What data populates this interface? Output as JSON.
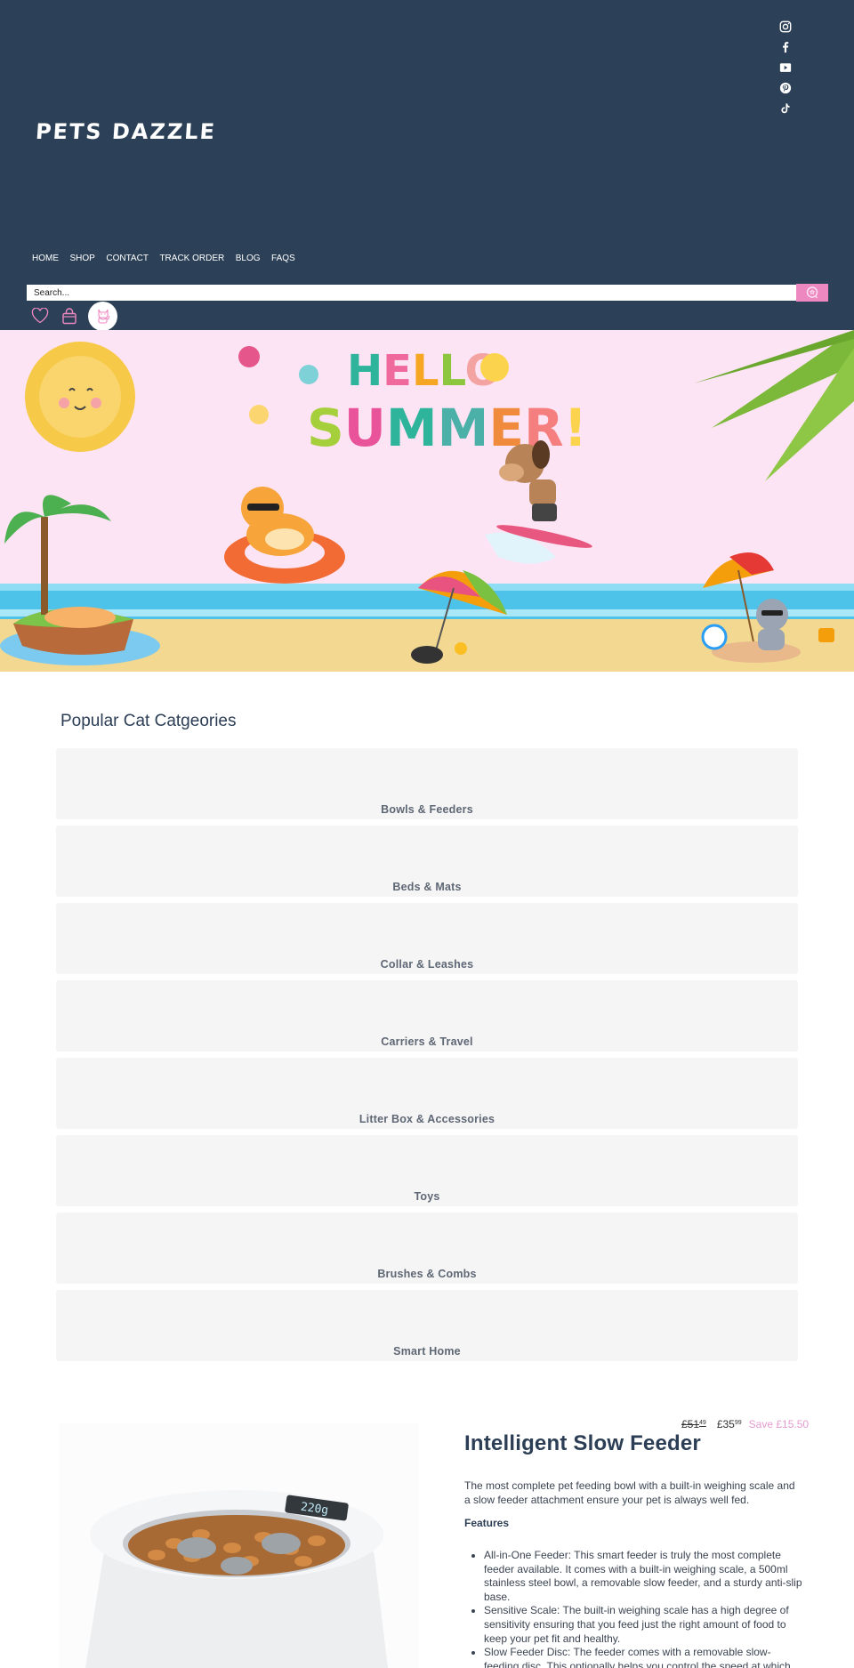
{
  "brand": {
    "name": "PETS DAZZLE"
  },
  "social": [
    {
      "icon": "instagram-icon",
      "label": "Instagram"
    },
    {
      "icon": "facebook-icon",
      "label": "Facebook"
    },
    {
      "icon": "youtube-icon",
      "label": "YouTube"
    },
    {
      "icon": "pinterest-icon",
      "label": "Pinterest"
    },
    {
      "icon": "tiktok-icon",
      "label": "TikTok"
    }
  ],
  "nav": [
    "HOME",
    "SHOP",
    "CONTACT",
    "TRACK ORDER",
    "BLOG",
    "FAQS"
  ],
  "search": {
    "placeholder": "Search..."
  },
  "header_icons": {
    "wishlist": "heart-icon",
    "cart": "bag-icon",
    "account": "cat-avatar-icon"
  },
  "banner": {
    "line1": "HELLO",
    "line2": "SUMMER!"
  },
  "categories": {
    "title": "Popular Cat Catgeories",
    "items": [
      "Bowls & Feeders",
      "Beds & Mats",
      "Collar & Leashes",
      "Carriers & Travel",
      "Litter Box & Accessories",
      "Toys",
      "Brushes & Combs",
      "Smart Home"
    ]
  },
  "product": {
    "title": "Intelligent Slow Feeder",
    "old_price_main": "£51",
    "old_price_cents": "49",
    "new_price_main": "£35",
    "new_price_cents": "99",
    "save": "Save £15.50",
    "description": "The most complete pet feeding bowl with a built-in weighing scale and a slow feeder attachment ensure your pet is always well fed.",
    "features_heading": "Features",
    "features": [
      "All-in-One Feeder: This smart feeder is truly the most complete feeder available. It comes with a built-in weighing scale, a 500ml stainless steel bowl, a removable slow feeder, and a sturdy anti-slip base.",
      "Sensitive Scale: The built-in weighing scale has a high degree of sensitivity ensuring that you feed just the right amount of food to keep your pet fit and healthy.",
      "Slow Feeder Disc: The feeder comes with a removable slow-feeding disc. This optionally helps you control the speed at which"
    ],
    "scale_display": "220g"
  },
  "colors": {
    "header_bg": "#2c4157",
    "accent_pink": "#ee88c0",
    "banner_bg": "#fde4f4",
    "card_bg": "#f6f5f6"
  }
}
